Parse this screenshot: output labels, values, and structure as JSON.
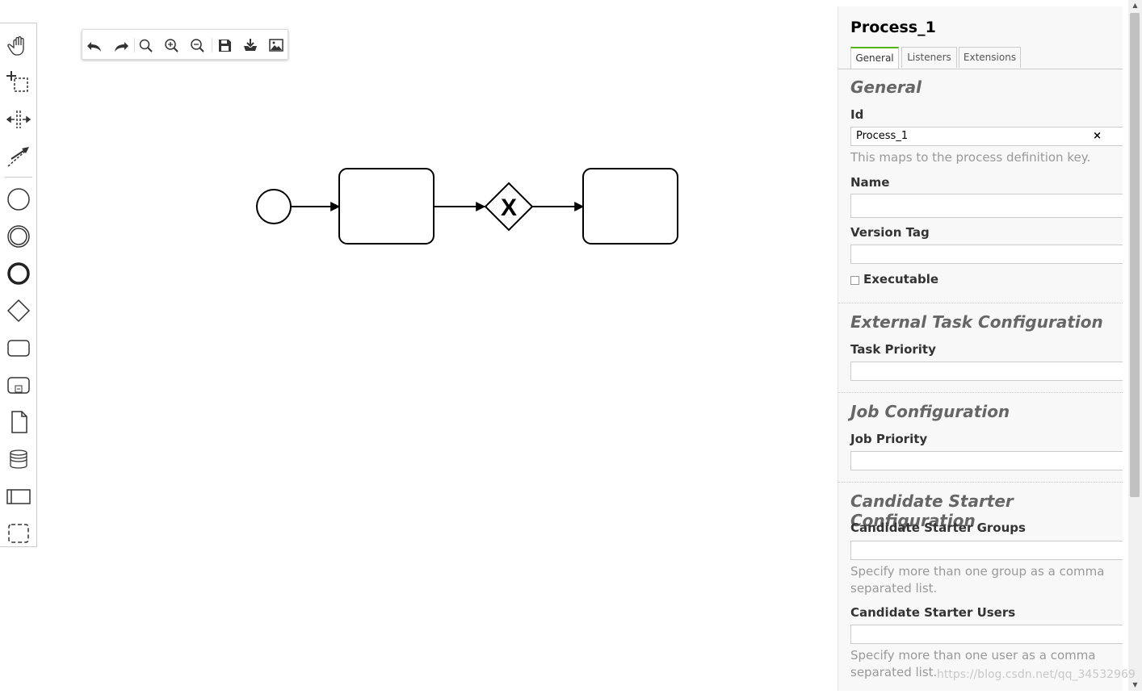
{
  "palette": {
    "tools": [
      "hand-tool",
      "lasso-tool",
      "space-tool",
      "global-connect-tool"
    ],
    "elements": [
      "start-event",
      "intermediate-event",
      "end-event",
      "gateway",
      "task",
      "subprocess",
      "data-object",
      "data-store",
      "participant",
      "group"
    ]
  },
  "toolbar": {
    "buttons": [
      "undo",
      "redo",
      "zoom-reset",
      "zoom-in",
      "zoom-out",
      "save",
      "download-bpmn",
      "download-image"
    ]
  },
  "diagram": {
    "elements": [
      "start-event",
      "task",
      "exclusive-gateway",
      "task"
    ],
    "gateway_marker": "X"
  },
  "panel": {
    "title": "Process_1",
    "tabs": [
      {
        "label": "General",
        "active": true
      },
      {
        "label": "Listeners",
        "active": false
      },
      {
        "label": "Extensions",
        "active": false
      }
    ],
    "general": {
      "group_title": "General",
      "id_label": "Id",
      "id_value": "Process_1",
      "id_clear": "×",
      "id_desc": "This maps to the process definition key.",
      "name_label": "Name",
      "name_value": "",
      "version_label": "Version Tag",
      "version_value": "",
      "executable_label": "Executable",
      "executable_checked": false
    },
    "external": {
      "group_title": "External Task Configuration",
      "priority_label": "Task Priority",
      "priority_value": ""
    },
    "job": {
      "group_title": "Job Configuration",
      "priority_label": "Job Priority",
      "priority_value": ""
    },
    "starter": {
      "group_title": "Candidate Starter Configuration",
      "groups_label": "Candidate Starter Groups",
      "groups_value": "",
      "groups_desc": "Specify more than one group as a comma separated list.",
      "users_label": "Candidate Starter Users",
      "users_value": "",
      "users_desc": "Specify more than one user as a comma separated list."
    }
  },
  "watermark": "https://blog.csdn.net/qq_34532969",
  "colors": {
    "tab_accent": "#52b415",
    "panel_bg": "#f8f8f8"
  }
}
